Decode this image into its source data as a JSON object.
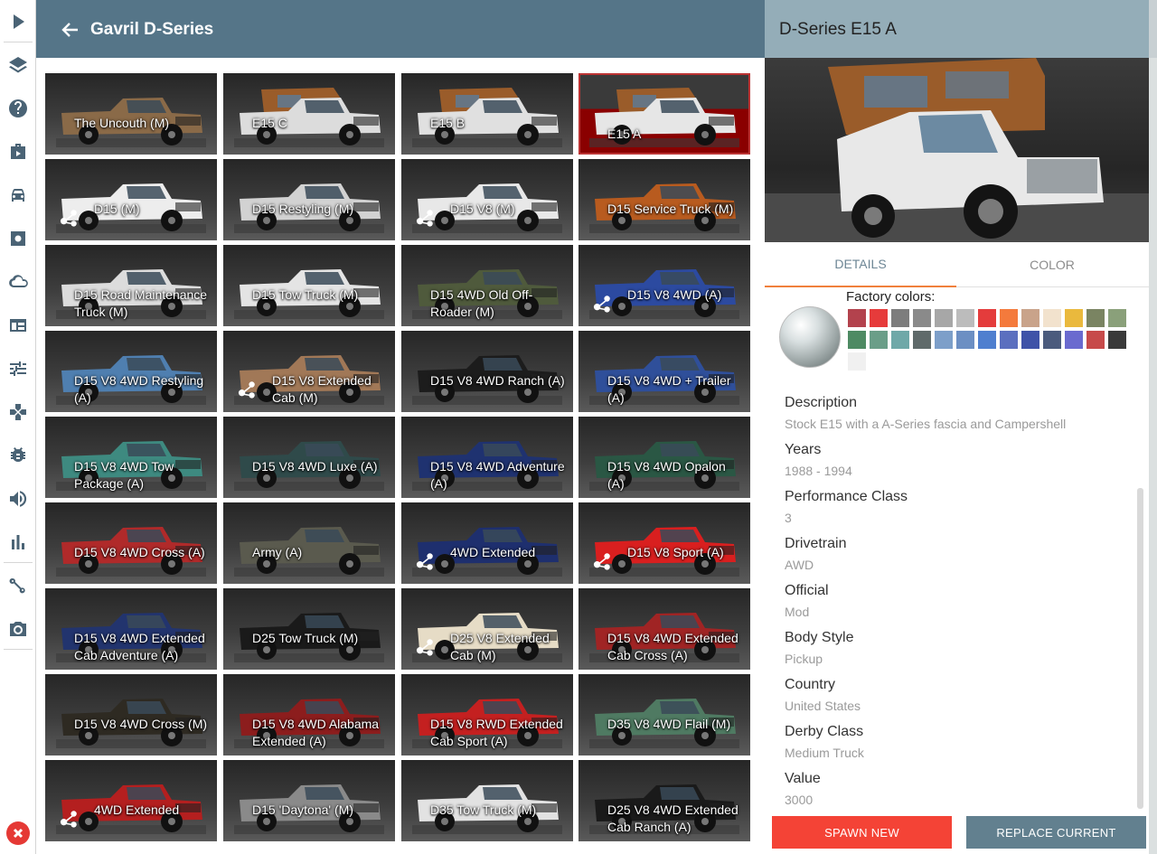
{
  "sidebar": {
    "icons": [
      "play-icon",
      "layers-icon",
      "help-icon",
      "briefcase-icon",
      "car-icon",
      "settings-icon",
      "cloud-icon",
      "browser-icon",
      "sliders-icon",
      "gamepad-icon",
      "bug-icon",
      "volume-icon",
      "bar-chart-icon",
      "route-icon",
      "camera-icon"
    ],
    "close_icon": "close-icon",
    "close_color": "#e53935"
  },
  "header": {
    "title": "Gavril D-Series",
    "back_icon": "arrow-left-icon",
    "background": "#557588"
  },
  "vehicles": [
    {
      "label": "The Uncouth (M)",
      "color": "#8a6a48",
      "camper": false,
      "shared": false
    },
    {
      "label": "E15 C",
      "color": "#dcdcdc",
      "camper": true,
      "shared": false
    },
    {
      "label": "E15 B",
      "color": "#e0e0e0",
      "camper": true,
      "shared": false
    },
    {
      "label": "E15 A",
      "color": "#e6e6e6",
      "camper": true,
      "shared": false,
      "selected": true
    },
    {
      "label": "D15 (M)",
      "color": "#ededed",
      "camper": false,
      "shared": true
    },
    {
      "label": "D15 Restyling (M)",
      "color": "#d2d2d2",
      "camper": false,
      "shared": false
    },
    {
      "label": "D15 V8 (M)",
      "color": "#e8e8e8",
      "camper": false,
      "shared": true
    },
    {
      "label": "D15 Service Truck (M)",
      "color": "#b85b1f",
      "camper": false,
      "shared": false
    },
    {
      "label": "D15 Road Maintenance Truck (M)",
      "color": "#dcdcdc",
      "camper": false,
      "shared": false
    },
    {
      "label": "D15 Tow Truck (M)",
      "color": "#e4e4e4",
      "camper": false,
      "shared": false
    },
    {
      "label": "D15 4WD Old Off-Roader (M)",
      "color": "#4f5a3c",
      "camper": false,
      "shared": false
    },
    {
      "label": "D15 V8 4WD (A)",
      "color": "#2c4aa0",
      "camper": false,
      "shared": true
    },
    {
      "label": "D15 V8 4WD Restyling (A)",
      "color": "#4f7fb0",
      "camper": false,
      "shared": false
    },
    {
      "label": "D15 V8 Extended Cab (M)",
      "color": "#a17857",
      "camper": false,
      "shared": true
    },
    {
      "label": "D15 V8 4WD Ranch (A)",
      "color": "#1c1c1c",
      "camper": false,
      "shared": false
    },
    {
      "label": "D15 V8 4WD + Trailer (A)",
      "color": "#2f4f9a",
      "camper": false,
      "shared": false
    },
    {
      "label": "D15 V8 4WD Tow Package (A)",
      "color": "#3e8a80",
      "camper": false,
      "shared": false
    },
    {
      "label": "D15 V8 4WD Luxe (A)",
      "color": "#2f4a4a",
      "camper": false,
      "shared": false
    },
    {
      "label": "D15 V8 4WD Adventure (A)",
      "color": "#1f3270",
      "camper": false,
      "shared": false
    },
    {
      "label": "D15 V8 4WD Opalon (A)",
      "color": "#2a5744",
      "camper": false,
      "shared": false
    },
    {
      "label": "D15 V8 4WD Cross (A)",
      "color": "#b02a2a",
      "camper": false,
      "shared": false
    },
    {
      "label": "Army (A)",
      "color": "#5a5a4e",
      "camper": false,
      "shared": false
    },
    {
      "label": "4WD Extended",
      "color": "#1e2f6e",
      "camper": false,
      "shared": true
    },
    {
      "label": "D15 V8 Sport (A)",
      "color": "#d91f1f",
      "camper": false,
      "shared": true
    },
    {
      "label": "D15 V8 4WD Extended Cab Adventure (A)",
      "color": "#22346e",
      "camper": false,
      "shared": false
    },
    {
      "label": "D25 Tow Truck (M)",
      "color": "#1a1a1a",
      "camper": false,
      "shared": false
    },
    {
      "label": "D25 V8 Extended Cab (M)",
      "color": "#e6dcc6",
      "camper": false,
      "shared": true
    },
    {
      "label": "D15 V8 4WD Extended Cab Cross (A)",
      "color": "#a02424",
      "camper": false,
      "shared": false
    },
    {
      "label": "D15 V8 4WD Cross (M)",
      "color": "#2e2a22",
      "camper": false,
      "shared": false
    },
    {
      "label": "D15 V8 4WD Alabama Extended (A)",
      "color": "#8c1d1d",
      "camper": false,
      "shared": false
    },
    {
      "label": "D15 V8 RWD Extended Cab Sport (A)",
      "color": "#c42020",
      "camper": false,
      "shared": false
    },
    {
      "label": "D35 V8 4WD Flail (M)",
      "color": "#4f7a62",
      "camper": false,
      "shared": false
    },
    {
      "label": "4WD Extended",
      "color": "#b41f1f",
      "camper": false,
      "shared": true
    },
    {
      "label": "D15 'Daytona' (M)",
      "color": "#8a8a8a",
      "camper": false,
      "shared": false
    },
    {
      "label": "D35 Tow Truck (M)",
      "color": "#e2e2e2",
      "camper": false,
      "shared": false
    },
    {
      "label": "D25 V8 4WD Extended Cab Ranch (A)",
      "color": "#1a1a1a",
      "camper": false,
      "shared": false
    }
  ],
  "detail": {
    "title": "D-Series E15 A",
    "tabs": {
      "details": "DETAILS",
      "color": "COLOR"
    },
    "factory_colors_label": "Factory colors:",
    "factory_colors": [
      "#b3424d",
      "#e63b3b",
      "#7d7d7d",
      "#8a8a8a",
      "#a7a7a7",
      "#bcbcbc",
      "#e43c3c",
      "#f47a3c",
      "#c9a38a",
      "#f2e2cd",
      "#eab93d",
      "#7a8462",
      "#8aa07a",
      "#4e8a63",
      "#6a9e88",
      "#6fa8a8",
      "#5f6a6a",
      "#7d9fc9",
      "#6c8fc3",
      "#4f7fcf",
      "#5b6fbf",
      "#3f53a8",
      "#4b5b7d",
      "#6a6acf",
      "#c74a4a",
      "#3a3a3a",
      "#f0f0f0"
    ],
    "properties": [
      {
        "label": "Description",
        "value": "Stock E15 with a A-Series fascia and Campershell"
      },
      {
        "label": "Years",
        "value": "1988 - 1994"
      },
      {
        "label": "Performance Class",
        "value": "3"
      },
      {
        "label": "Drivetrain",
        "value": "AWD"
      },
      {
        "label": "Official",
        "value": "Mod"
      },
      {
        "label": "Body Style",
        "value": "Pickup"
      },
      {
        "label": "Country",
        "value": "United States"
      },
      {
        "label": "Derby Class",
        "value": "Medium Truck"
      },
      {
        "label": "Value",
        "value": "3000"
      }
    ],
    "spawn_label": "SPAWN NEW",
    "replace_label": "REPLACE CURRENT",
    "spawn_color": "#f44336",
    "replace_color": "#62808f",
    "tab_accent": "#f0803c"
  }
}
